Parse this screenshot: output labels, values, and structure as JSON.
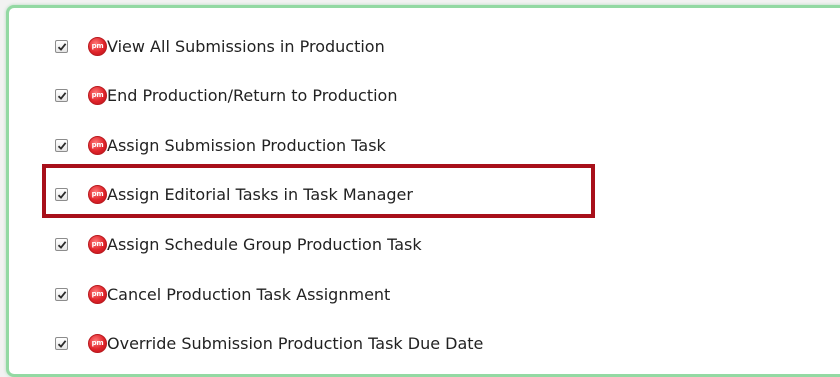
{
  "panel": {
    "accent_border_color": "#93d9a3",
    "highlight_color": "#a8101a",
    "badge_icon": "pm-badge-icon",
    "badge_text": "pm",
    "items": [
      {
        "label": "View All Submissions in Production",
        "checked": true
      },
      {
        "label": "End Production/Return to Production",
        "checked": true
      },
      {
        "label": "Assign Submission Production Task",
        "checked": true
      },
      {
        "label": "Assign Editorial Tasks in Task Manager",
        "checked": true,
        "highlighted": true
      },
      {
        "label": "Assign Schedule Group Production Task",
        "checked": true
      },
      {
        "label": "Cancel Production Task Assignment",
        "checked": true
      },
      {
        "label": "Override Submission Production Task Due Date",
        "checked": true
      }
    ]
  }
}
